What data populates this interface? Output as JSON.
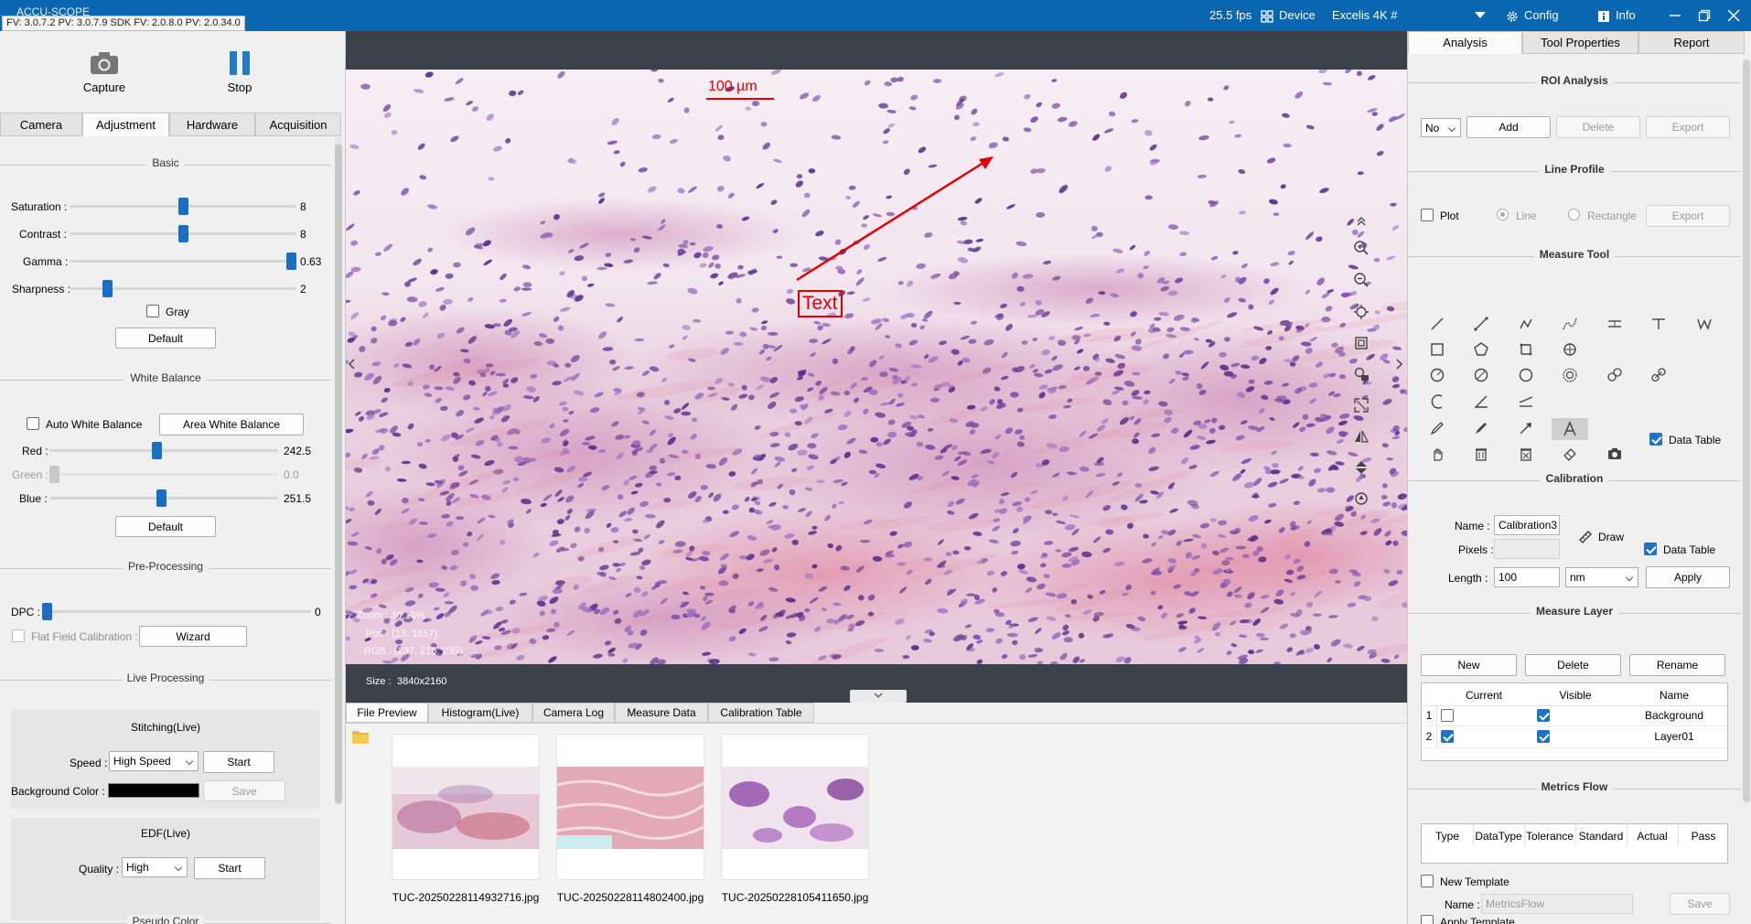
{
  "titlebar": {
    "app_name": "ACCU-SCOPE",
    "firmware": "FV: 3.0.7.2 PV: 3.0.7.9 SDK FV: 2.0.8.0 PV: 2.0.34.0",
    "fps": "25.5 fps",
    "device_label": "Device",
    "camera_name": "Excelis 4K #",
    "config_label": "Config",
    "info_label": "Info"
  },
  "left": {
    "capture_label": "Capture",
    "stop_label": "Stop",
    "tabs": [
      "Camera",
      "Adjustment",
      "Hardware",
      "Acquisition"
    ],
    "active_tab": "Adjustment",
    "basic": {
      "title": "Basic",
      "saturation_label": "Saturation :",
      "saturation_value": "8",
      "saturation_level": 0.5,
      "contrast_label": "Contrast :",
      "contrast_value": "8",
      "contrast_level": 0.5,
      "gamma_label": "Gamma :",
      "gamma_value": "0.63",
      "gamma_level": 1.0,
      "sharpness_label": "Sharpness :",
      "sharpness_value": "2",
      "sharpness_level": 0.15,
      "gray_label": "Gray",
      "default_label": "Default"
    },
    "white_balance": {
      "title": "White Balance",
      "auto_label": "Auto White Balance",
      "area_label": "Area White Balance",
      "red_label": "Red :",
      "red_value": "242.5",
      "red_level": 0.47,
      "green_label": "Green :",
      "green_value": "0.0",
      "green_level": 0.0,
      "blue_label": "Blue :",
      "blue_value": "251.5",
      "blue_level": 0.49,
      "default_label": "Default"
    },
    "pre_processing": {
      "title": "Pre-Processing",
      "dpc_label": "DPC :",
      "dpc_value": "0",
      "dpc_level": 0.0,
      "ffc_label": "Flat Field Calibration :",
      "wizard_label": "Wizard"
    },
    "live_processing": {
      "title": "Live Processing",
      "stitching_title": "Stitching(Live)",
      "speed_label": "Speed :",
      "speed_value": "High Speed",
      "start_label": "Start",
      "bg_color_label": "Background Color :",
      "bg_color": "#000000",
      "save_label": "Save",
      "edf_title": "EDF(Live)",
      "quality_label": "Quality :",
      "quality_value": "High"
    },
    "pseudo_color_title": "Pseudo Color"
  },
  "center": {
    "scalebar_label": "100 µm",
    "text_annotation": "Text",
    "zoom": "Zoom :  30.16%",
    "pos": "Pos :  (13, 1657)",
    "rgb": "RGB :  (237, 215, 235)",
    "size_label": "Size :",
    "size_value": "3840x2160",
    "preview_tabs": [
      "File Preview",
      "Histogram(Live)",
      "Camera Log",
      "Measure Data",
      "Calibration Table"
    ],
    "files": [
      "TUC-20250228114932716.jpg",
      "TUC-20250228114802400.jpg",
      "TUC-20250228105411650.jpg"
    ]
  },
  "right": {
    "tabs": [
      "Analysis",
      "Tool Properties",
      "Report"
    ],
    "active_tab": "Analysis",
    "roi": {
      "title": "ROI Analysis",
      "select_value": "No",
      "add": "Add",
      "delete": "Delete",
      "export": "Export"
    },
    "line_profile": {
      "title": "Line Profile",
      "plot": "Plot",
      "line": "Line",
      "rectangle": "Rectangle",
      "export": "Export"
    },
    "measure_tool": {
      "title": "Measure Tool",
      "data_table": "Data Table"
    },
    "calibration": {
      "title": "Calibration",
      "name_label": "Name :",
      "name_value": "Calibration3",
      "draw_label": "Draw",
      "pixels_label": "Pixels :",
      "data_table": "Data Table",
      "length_label": "Length :",
      "length_value": "100",
      "unit_value": "nm",
      "apply": "Apply"
    },
    "measure_layer": {
      "title": "Measure Layer",
      "new": "New",
      "delete": "Delete",
      "rename": "Rename",
      "columns": [
        "Current",
        "Visible",
        "Name"
      ],
      "rows": [
        {
          "num": "1",
          "name": "Background"
        },
        {
          "num": "2",
          "name": "Layer01"
        }
      ]
    },
    "metrics_flow": {
      "title": "Metrics Flow",
      "columns": [
        "Type",
        "DataType",
        "Tolerance",
        "Standard",
        "Actual",
        "Pass"
      ],
      "new_template": "New Template",
      "name_label": "Name :",
      "name_placeholder": "MetricsFlow",
      "save": "Save",
      "apply_template": "Apply Template"
    }
  }
}
